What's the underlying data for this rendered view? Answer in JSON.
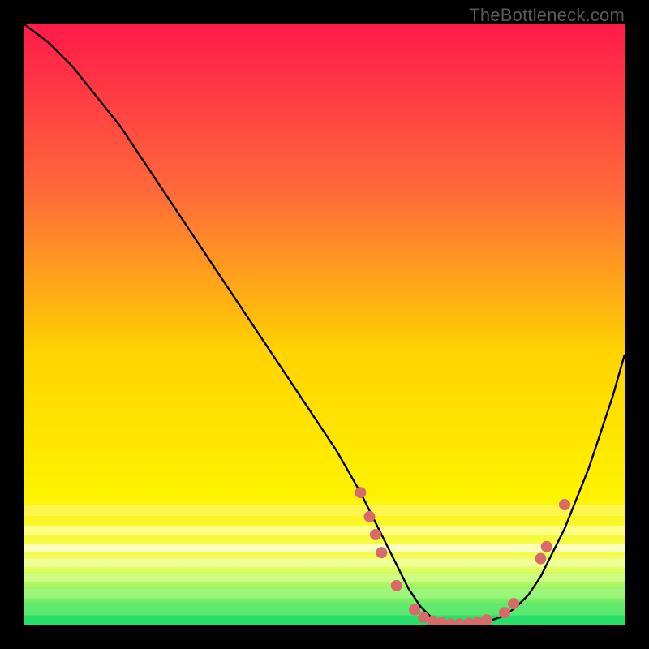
{
  "watermark": "TheBottleneck.com",
  "colors": {
    "gradient_top": "#ff1a4a",
    "gradient_mid1": "#ff6a3a",
    "gradient_mid2": "#ffd400",
    "gradient_mid3": "#fff200",
    "gradient_mid4": "#f0ff60",
    "gradient_bottom": "#26e06a",
    "curve": "#000000",
    "dots": "#d86a6a",
    "background": "#000000"
  },
  "chart_data": {
    "type": "line",
    "title": "",
    "xlabel": "",
    "ylabel": "",
    "xlim": [
      0,
      100
    ],
    "ylim": [
      0,
      100
    ],
    "series": [
      {
        "name": "bottleneck-curve",
        "x": [
          0,
          4,
          8,
          12,
          16,
          20,
          24,
          28,
          32,
          36,
          40,
          44,
          48,
          52,
          56,
          58,
          60,
          62,
          64,
          66,
          68,
          70,
          72,
          74,
          76,
          78,
          80,
          82,
          84,
          86,
          88,
          90,
          92,
          94,
          96,
          98,
          100
        ],
        "y": [
          100,
          97,
          93,
          88,
          83,
          77,
          71,
          65,
          59,
          53,
          47,
          41,
          35,
          29,
          22,
          18,
          14,
          10,
          6,
          3,
          1,
          0.3,
          0,
          0.2,
          0.4,
          0.8,
          1.5,
          3,
          5,
          8,
          12,
          16,
          21,
          26,
          32,
          38,
          45
        ]
      }
    ],
    "scatter_points": {
      "name": "highlight-dots",
      "points": [
        {
          "x": 56.0,
          "y": 22.0
        },
        {
          "x": 57.5,
          "y": 18.0
        },
        {
          "x": 58.5,
          "y": 15.0
        },
        {
          "x": 59.5,
          "y": 12.0
        },
        {
          "x": 62.0,
          "y": 6.5
        },
        {
          "x": 65.0,
          "y": 2.5
        },
        {
          "x": 66.5,
          "y": 1.2
        },
        {
          "x": 68.0,
          "y": 0.6
        },
        {
          "x": 69.5,
          "y": 0.3
        },
        {
          "x": 71.0,
          "y": 0.1
        },
        {
          "x": 72.5,
          "y": 0.1
        },
        {
          "x": 74.0,
          "y": 0.2
        },
        {
          "x": 75.5,
          "y": 0.4
        },
        {
          "x": 77.0,
          "y": 0.8
        },
        {
          "x": 80.0,
          "y": 2.0
        },
        {
          "x": 81.5,
          "y": 3.5
        },
        {
          "x": 86.0,
          "y": 11.0
        },
        {
          "x": 87.0,
          "y": 13.0
        },
        {
          "x": 90.0,
          "y": 20.0
        }
      ]
    }
  }
}
